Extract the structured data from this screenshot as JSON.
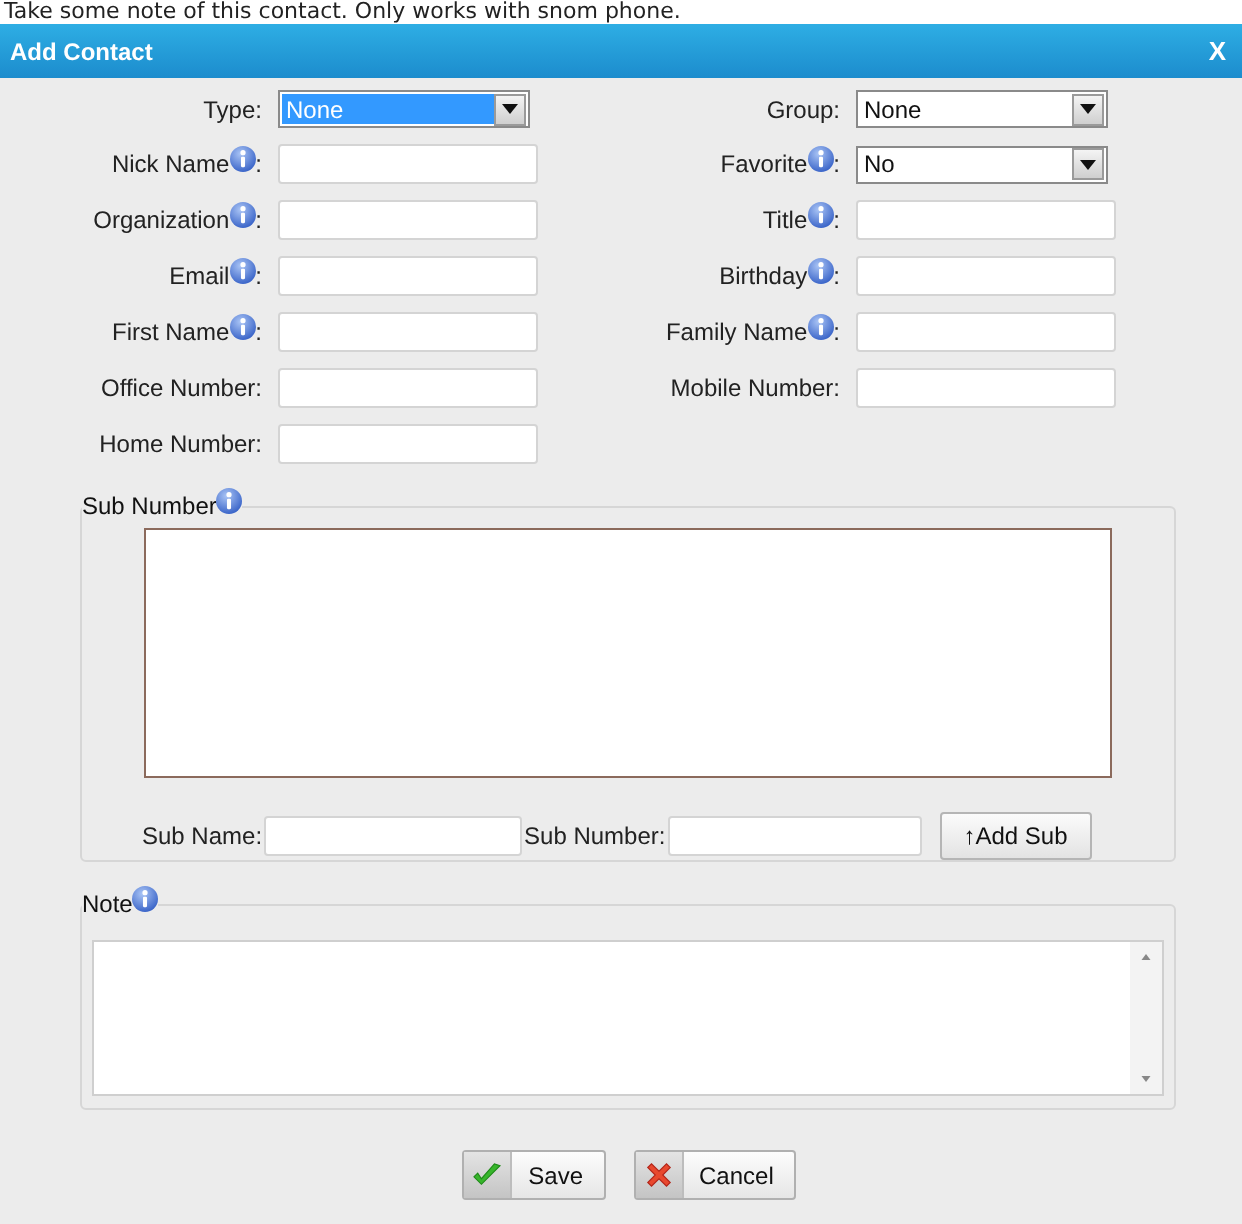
{
  "hint_text": "Take some note of this contact. Only works with snom phone.",
  "dialog": {
    "title": "Add Contact",
    "close_label": "X"
  },
  "fields": [
    {
      "label": "Type",
      "suffix": ":",
      "info": false,
      "kind": "select",
      "value": "None",
      "focused": true
    },
    {
      "label": "Group",
      "suffix": ":",
      "info": false,
      "kind": "select",
      "value": "None",
      "focused": false
    },
    {
      "label": "Nick Name",
      "suffix": ":",
      "info": true,
      "kind": "input"
    },
    {
      "label": "Favorite",
      "suffix": ":",
      "info": true,
      "kind": "select",
      "value": "No",
      "focused": false
    },
    {
      "label": "Organization",
      "suffix": ":",
      "info": true,
      "kind": "input"
    },
    {
      "label": "Title",
      "suffix": ":",
      "info": true,
      "kind": "input"
    },
    {
      "label": "Email",
      "suffix": ":",
      "info": true,
      "kind": "input"
    },
    {
      "label": "Birthday",
      "suffix": ":",
      "info": true,
      "kind": "input"
    },
    {
      "label": "First Name",
      "suffix": ":",
      "info": true,
      "kind": "input"
    },
    {
      "label": "Family Name",
      "suffix": ":",
      "info": true,
      "kind": "input"
    },
    {
      "label": "Office Number",
      "suffix": ":",
      "info": false,
      "kind": "input"
    },
    {
      "label": "Mobile Number",
      "suffix": ":",
      "info": false,
      "kind": "input"
    },
    {
      "label": "Home Number",
      "suffix": ":",
      "info": false,
      "kind": "input"
    }
  ],
  "sub_numbers": {
    "legend": "Sub Number",
    "info": true,
    "sub_name_label": "Sub Name:",
    "sub_number_label": "Sub Number:",
    "add_button": "↑Add Sub"
  },
  "note": {
    "legend": "Note",
    "info": true
  },
  "buttons": [
    {
      "label": "Save",
      "kind": "save"
    },
    {
      "label": "Cancel",
      "kind": "cancel"
    }
  ]
}
